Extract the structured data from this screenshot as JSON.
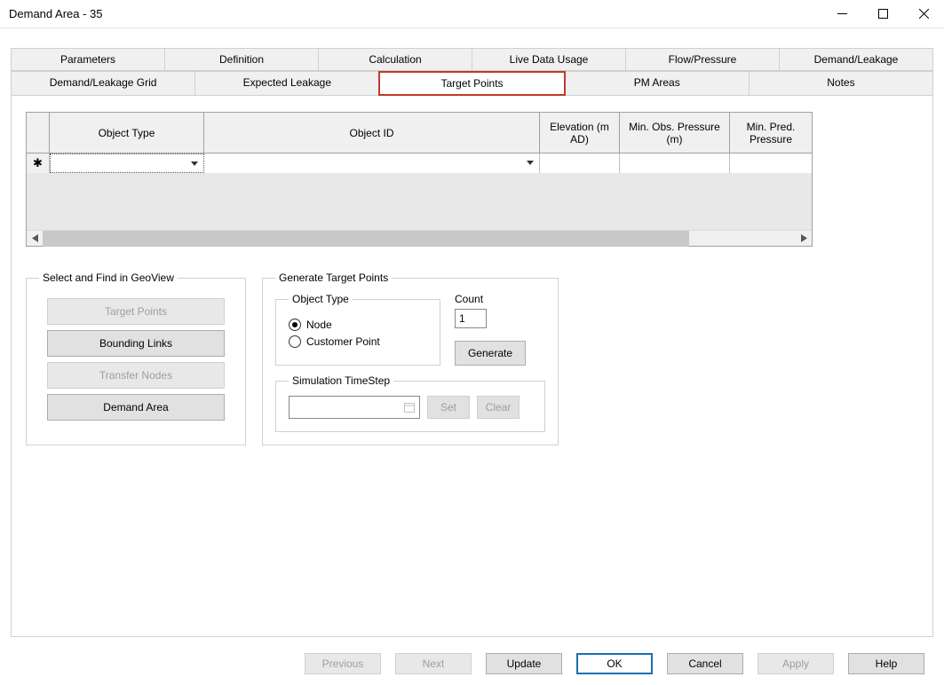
{
  "window": {
    "title": "Demand Area - 35"
  },
  "tabs_row1": [
    {
      "label": "Parameters"
    },
    {
      "label": "Definition"
    },
    {
      "label": "Calculation"
    },
    {
      "label": "Live Data Usage"
    },
    {
      "label": "Flow/Pressure"
    },
    {
      "label": "Demand/Leakage"
    }
  ],
  "tabs_row2": [
    {
      "label": "Demand/Leakage Grid"
    },
    {
      "label": "Expected Leakage"
    },
    {
      "label": "Target Points",
      "selected": true
    },
    {
      "label": "PM Areas"
    },
    {
      "label": "Notes"
    }
  ],
  "grid": {
    "headers": [
      "",
      "Object Type",
      "Object ID",
      "Elevation (m AD)",
      "Min. Obs. Pressure (m)",
      "Min. Pred. Pressure"
    ],
    "new_row_marker": "✱"
  },
  "geoview": {
    "legend": "Select and Find in GeoView",
    "buttons": [
      {
        "label": "Target Points",
        "enabled": false
      },
      {
        "label": "Bounding Links",
        "enabled": true
      },
      {
        "label": "Transfer Nodes",
        "enabled": false
      },
      {
        "label": "Demand Area",
        "enabled": true
      }
    ]
  },
  "generate": {
    "legend": "Generate Target Points",
    "object_type_legend": "Object Type",
    "radios": {
      "node": "Node",
      "customer_point": "Customer Point",
      "selected": "node"
    },
    "count_label": "Count",
    "count_value": "1",
    "generate_btn": "Generate",
    "simstep_legend": "Simulation TimeStep",
    "set_btn": "Set",
    "clear_btn": "Clear"
  },
  "bottom": {
    "previous": "Previous",
    "next": "Next",
    "update": "Update",
    "ok": "OK",
    "cancel": "Cancel",
    "apply": "Apply",
    "help": "Help"
  }
}
